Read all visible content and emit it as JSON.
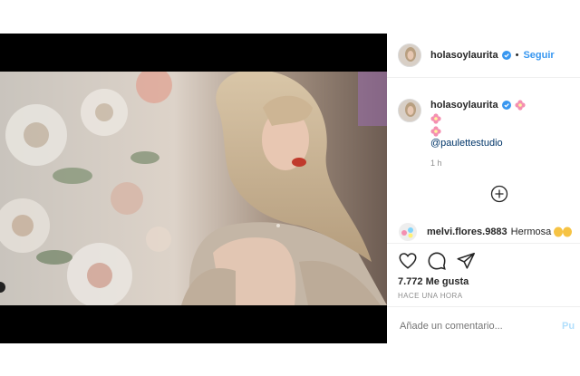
{
  "post": {
    "username": "holasoylaurita",
    "follow_label": "Seguir",
    "separator": "•",
    "caption_mention": "@paulettestudio",
    "caption_time": "1 h",
    "comment": {
      "username": "melvi.flores.9883",
      "text": "Hermosa"
    },
    "likes": "7.772 Me gusta",
    "posted_ago": "HACE UNA HORA",
    "comment_placeholder": "Añade un comentario...",
    "publish_label": "Pu"
  },
  "colors": {
    "accent": "#3897f0",
    "verified": "#3897f0",
    "mention": "#003569",
    "muted": "#8e8e8e"
  },
  "icons": [
    "verified-icon",
    "flower-icon",
    "plus-circle-icon",
    "heart-icon",
    "comment-icon",
    "share-icon"
  ]
}
